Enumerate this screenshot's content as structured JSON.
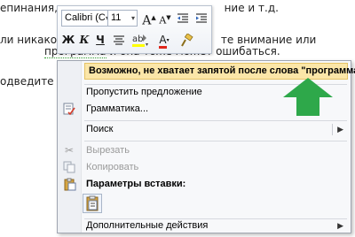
{
  "document": {
    "line1_a": "епинания, н",
    "line1_b": "ние и т.д.",
    "line2_a": "ли никакой",
    "line2_b": "те внимание или",
    "line3_sq": "программа",
    "line3_b": " и она тоже может ошибаться.",
    "line4_a": "одведите ку"
  },
  "mini_toolbar": {
    "font_name": "Calibri (С",
    "font_size": "11",
    "grow_font": "A",
    "shrink_font": "A",
    "bold": "Ж",
    "italic": "К",
    "underline": "Ч",
    "font_color_letter": "A"
  },
  "context_menu": {
    "suggestion": "Возможно, не хватает запятой после слова \"программа\".",
    "ignore_once": "Пропустить предложение",
    "grammar": "Грамматика...",
    "search": "Поиск",
    "cut": "Вырезать",
    "copy": "Копировать",
    "paste_options": "Параметры вставки:",
    "more_actions": "Дополнительные действия"
  },
  "colors": {
    "suggestion_bg": "#fbe6a8",
    "arrow_green": "#2ea84a",
    "squiggle": "#2e9b2e"
  }
}
